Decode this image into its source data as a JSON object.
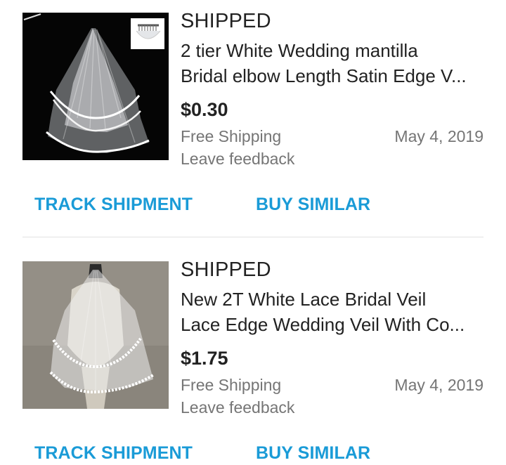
{
  "orders": [
    {
      "status": "SHIPPED",
      "title_line1": "2 tier White Wedding mantilla",
      "title_line2": "Bridal elbow Length Satin Edge V...",
      "price": "$0.30",
      "shipping": "Free Shipping",
      "date": "May 4, 2019",
      "feedback": "Leave feedback",
      "track_label": "TRACK SHIPMENT",
      "buy_label": "BUY SIMILAR"
    },
    {
      "status": "SHIPPED",
      "title_line1": "New 2T White Lace Bridal Veil",
      "title_line2": "Lace Edge Wedding Veil With Co...",
      "price": "$1.75",
      "shipping": "Free Shipping",
      "date": "May 4, 2019",
      "feedback": "Leave feedback",
      "track_label": "TRACK SHIPMENT",
      "buy_label": "BUY SIMILAR"
    }
  ],
  "colors": {
    "action": "#1a9bd7",
    "muted": "#757575",
    "text": "#222222"
  }
}
